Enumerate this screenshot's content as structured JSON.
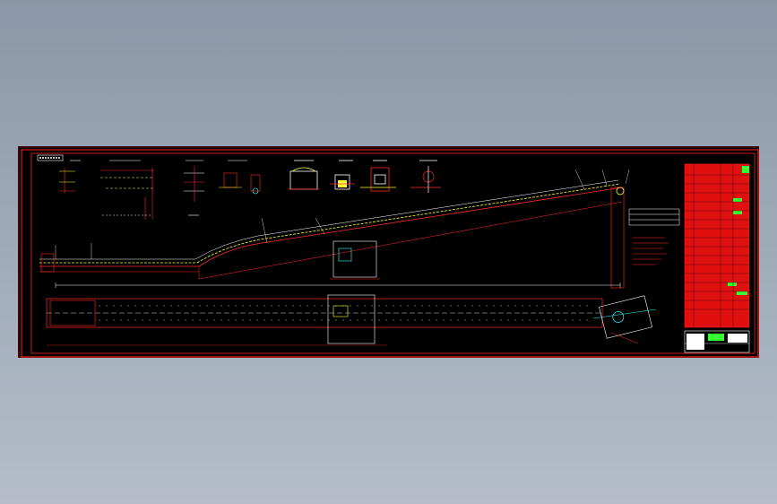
{
  "drawing": {
    "title_tag": "",
    "colors": {
      "background": "#000000",
      "frame": "#ff2020",
      "line_red": "#ff2a2a",
      "line_yellow": "#ffff33",
      "line_white": "#ffffff",
      "line_cyan": "#33ffff",
      "line_green": "#33ff33",
      "fill_red": "#e01010"
    },
    "icons": [
      "section-detail-icon",
      "roller-section-icon",
      "title-block-logo-icon"
    ]
  }
}
